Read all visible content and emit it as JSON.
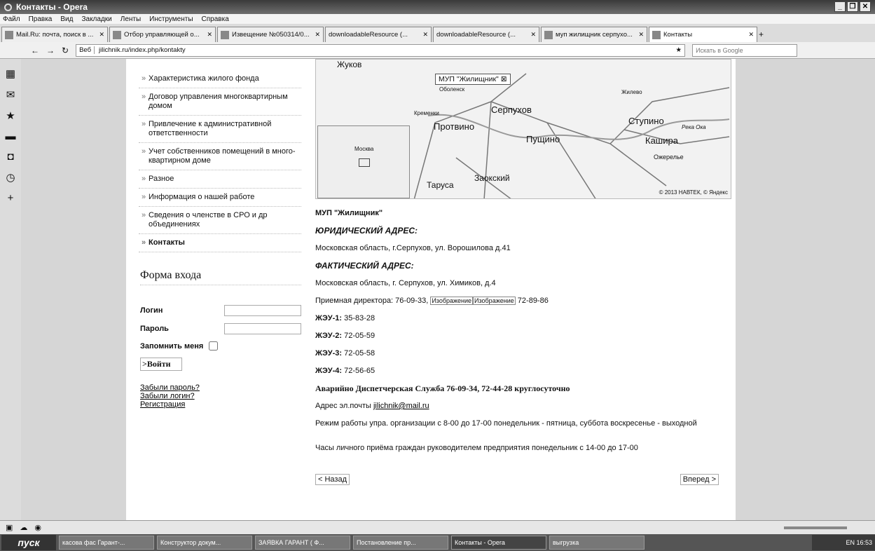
{
  "window": {
    "title": "Контакты - Opera"
  },
  "menubar": [
    "Файл",
    "Правка",
    "Вид",
    "Закладки",
    "Ленты",
    "Инструменты",
    "Справка"
  ],
  "tabs": [
    {
      "label": "Mail.Ru: почта, поиск в ..."
    },
    {
      "label": "Отбор управляющей о..."
    },
    {
      "label": "Извещение №050314/0..."
    },
    {
      "label": "downloadableResource (..."
    },
    {
      "label": "downloadableResource (..."
    },
    {
      "label": "муп жилищник серпухо..."
    },
    {
      "label": "Контакты"
    }
  ],
  "addressbar": {
    "badge": "Веб",
    "url": "jilichnik.ru/index.php/kontakty",
    "search_placeholder": "Искать в Google"
  },
  "nav": [
    {
      "label": "Характеристика жилого фонда"
    },
    {
      "label": "Договор управления многоквартирным домом"
    },
    {
      "label": "Привлечение к административной ответственности"
    },
    {
      "label": "Учет собственников помещений в много-квартирном доме"
    },
    {
      "label": "Разное"
    },
    {
      "label": "Информация о нашей работе"
    },
    {
      "label": "Сведения о членстве в СРО и др объединениях"
    },
    {
      "label": "Контакты"
    }
  ],
  "login": {
    "title": "Форма входа",
    "login_label": "Логин",
    "password_label": "Пароль",
    "remember_label": "Запомнить меня",
    "submit_label": ">Войти",
    "forgot_password": "Забыли пароль?",
    "forgot_login": "Забыли логин?",
    "register": "Регистрация"
  },
  "map": {
    "balloon": "МУП \"Жилищник\"",
    "labels": {
      "zhukov": "Жуков",
      "obolensk": "Оболенск",
      "zhilevo": "Жилево",
      "serpukhov": "Серпухов",
      "protvino": "Протвино",
      "stupino": "Ступино",
      "oka": "Река Ока",
      "pushchino": "Пущино",
      "kashira": "Кашира",
      "ozherelye": "Ожерелье",
      "moskva": "Москва",
      "tarusa": "Таруса",
      "zaokskiy": "Заокский",
      "kremenki": "Кременки"
    },
    "copyright": "© 2013 НАВТЕК, © Яндекс"
  },
  "contacts": {
    "org": "МУП \"Жилищник\"",
    "legal_header": "ЮРИДИЧЕСКИЙ АДРЕС:",
    "legal_address": "Московская область, г.Серпухов, ул. Ворошилова д.41",
    "actual_header": "ФАКТИЧЕСКИЙ АДРЕС:",
    "actual_address": "Московская область, г. Серпухов, ул. Химиков, д.4",
    "reception_prefix": "Приемная директора: 76-09-33,",
    "image_placeholder_1": "Изображение",
    "image_placeholder_2": "Изображение",
    "reception_suffix": "72-89-86",
    "zheu": [
      {
        "name": "ЖЭУ-1:",
        "phone": "35-83-28"
      },
      {
        "name": "ЖЭУ-2:",
        "phone": "72-05-59"
      },
      {
        "name": "ЖЭУ-3:",
        "phone": "72-05-58"
      },
      {
        "name": "ЖЭУ-4:",
        "phone": "72-56-65"
      }
    ],
    "emergency": "Аварийно Диспетчерская Служба 76-09-34, 72-44-28 круглосуточно",
    "email_prefix": "Адрес эл.почты",
    "email": "jilichnik@mail.ru",
    "hours": "Режим работы упра. организации с 8-00 до 17-00 понедельник - пятница, суббота воскресенье - выходной",
    "reception_hours": "Часы личного приёма граждан руководителем предприятия понедельник с 14-00 до 17-00"
  },
  "pager": {
    "prev": "< Назад",
    "next": "Вперед >"
  },
  "taskbar": {
    "start": "пуск",
    "tasks": [
      {
        "label": "касова фас Гарант-..."
      },
      {
        "label": "Конструктор докум..."
      },
      {
        "label": "ЗАЯВКА ГАРАНТ ( Ф..."
      },
      {
        "label": "Постановление пр..."
      },
      {
        "label": "Контакты - Opera"
      },
      {
        "label": "выгрузка"
      }
    ],
    "tray_text": "EN  16:53"
  }
}
